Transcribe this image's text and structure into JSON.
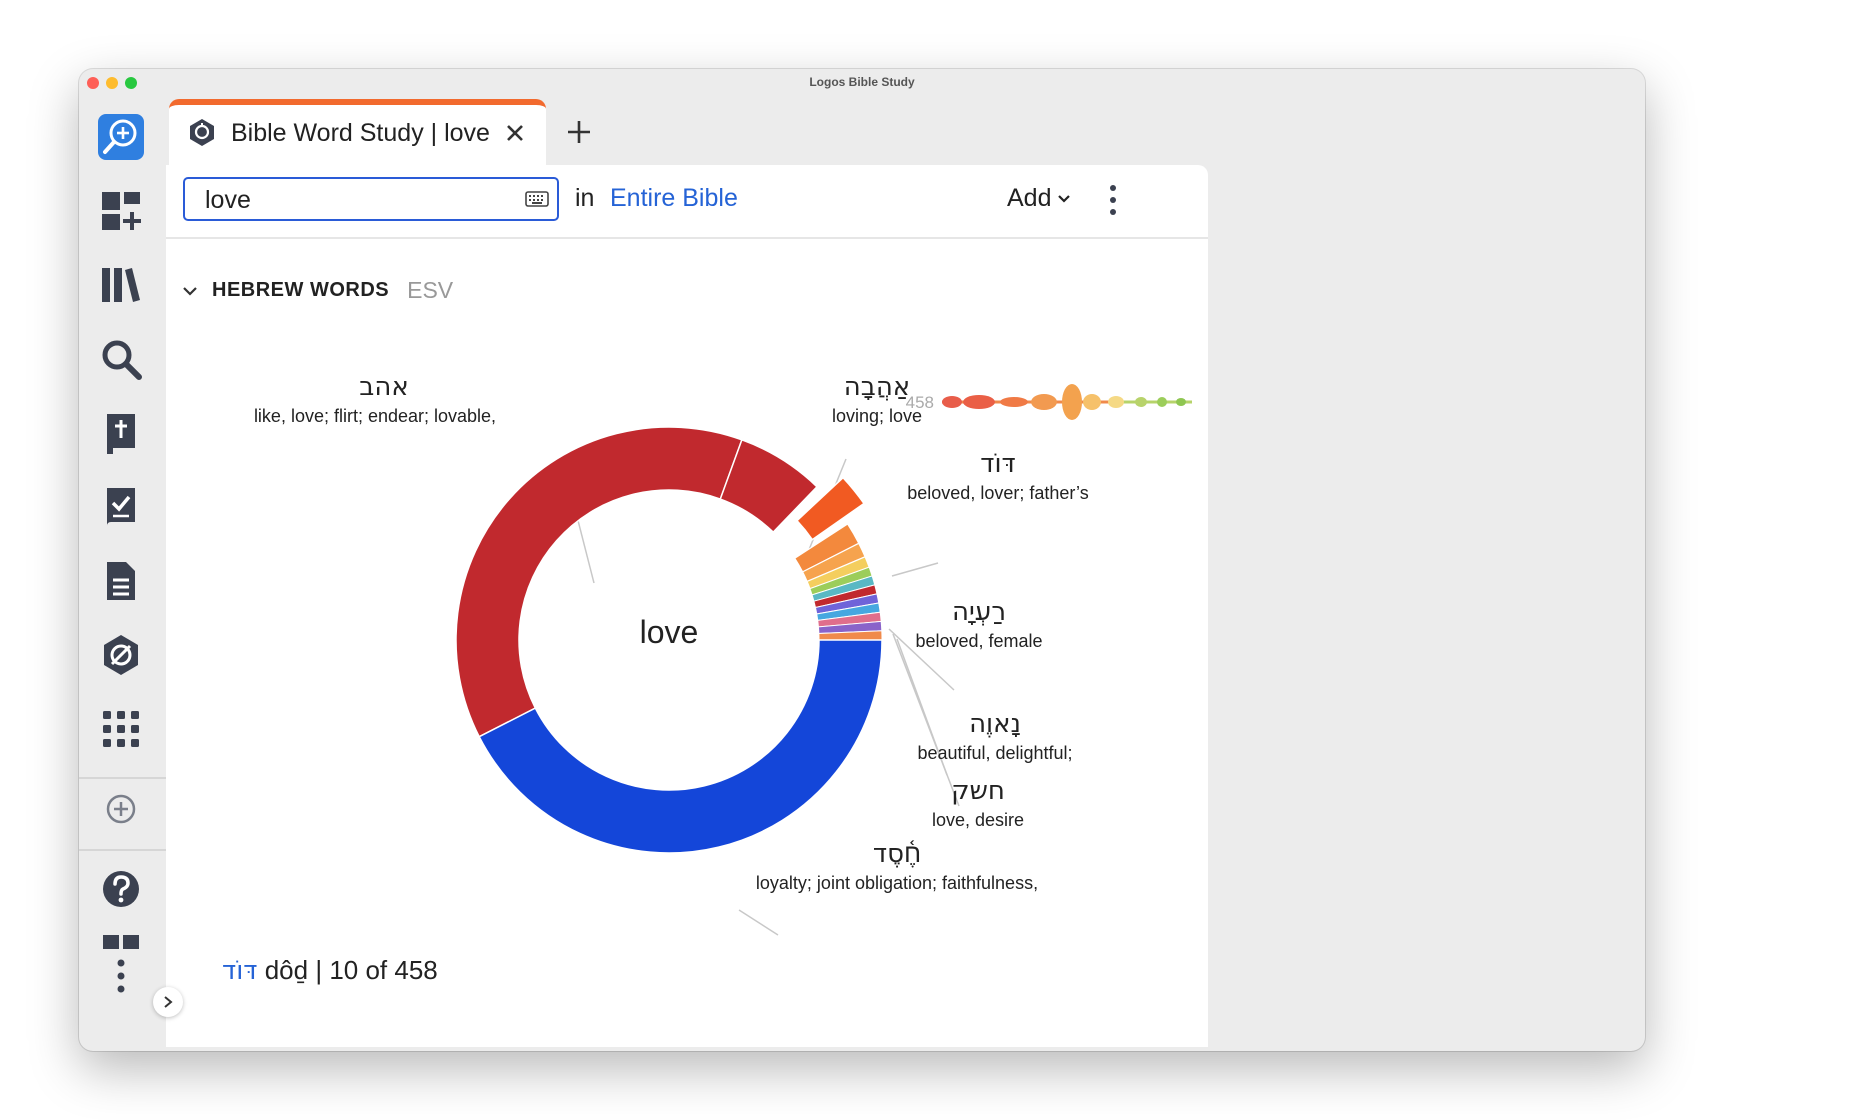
{
  "window": {
    "title": "Logos Bible Study"
  },
  "tab": {
    "title": "Bible Word Study | love"
  },
  "search": {
    "value": "love"
  },
  "toolbar": {
    "in_label": "in",
    "scope": "Entire Bible",
    "add_label": "Add"
  },
  "section": {
    "title": "HEBREW WORDS",
    "version": "ESV"
  },
  "chart_data": {
    "type": "pie",
    "center_label": "love",
    "total_label": "458",
    "colors": {
      "ahab": "#c1292e",
      "ahavah": "#c1292e",
      "dod": "#f15a22",
      "hesed": "#1446d9"
    },
    "slices": [
      {
        "word": "אהב",
        "gloss": "like, love; flirt; endear; lovable,",
        "value": 217
      },
      {
        "word": "אַהֲבָה",
        "gloss": "loving; love",
        "value": 40
      },
      {
        "word": "דּוֹד",
        "gloss": "beloved, lover; father’s",
        "value": 10
      },
      {
        "word": "רַעְיָה",
        "gloss": "beloved, female",
        "value": 10
      },
      {
        "word": "נָאוֶה",
        "gloss": "beautiful, delightful;",
        "value": 5
      },
      {
        "word": "חשק",
        "gloss": "love, desire",
        "value": 4
      },
      {
        "word": "חֶ֫סֶד",
        "gloss": "loyalty; joint obligation; faithfulness,",
        "value": 128
      }
    ]
  },
  "footer": {
    "hebrew": "דּוֹד",
    "translit": "dôḏ",
    "count": "10 of 458"
  }
}
